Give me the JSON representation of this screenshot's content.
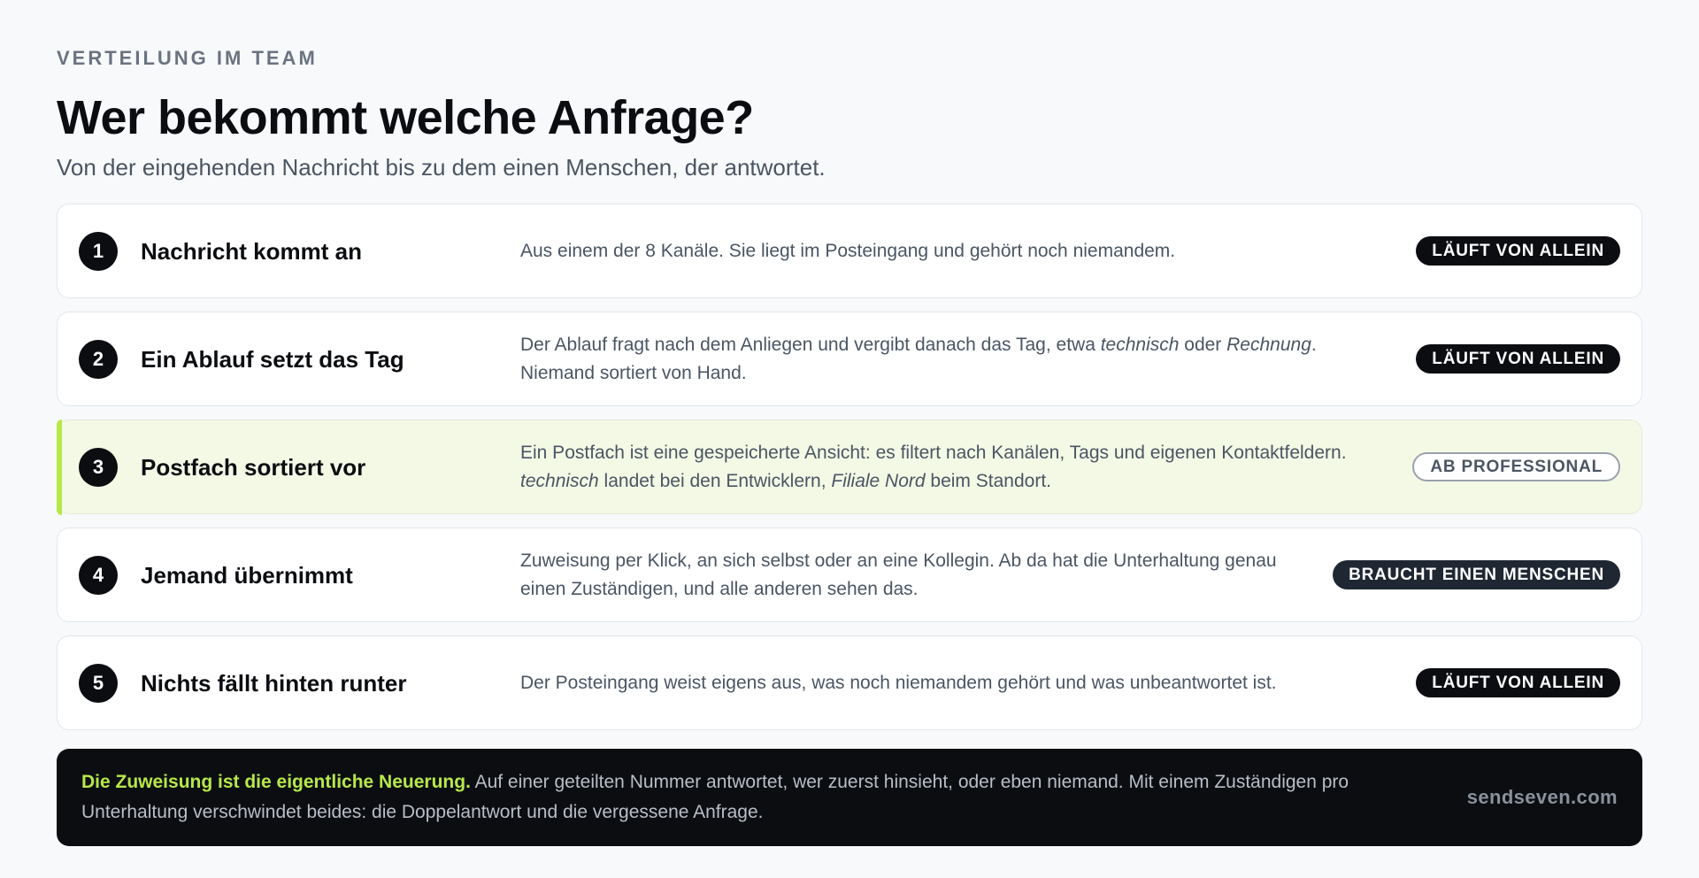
{
  "header": {
    "eyebrow": "VERTEILUNG IM TEAM",
    "title": "Wer bekommt welche Anfrage?",
    "subtitle": "Von der eingehenden Nachricht bis zu dem einen Menschen, der antwortet."
  },
  "steps": [
    {
      "number": "1",
      "title": "Nachricht kommt an",
      "desc_parts": [
        "Aus einem der 8 Kanäle. Sie liegt im Posteingang und gehört noch niemandem."
      ],
      "badge": "LÄUFT VON ALLEIN",
      "badge_style": "auto"
    },
    {
      "number": "2",
      "title": "Ein Ablauf setzt das Tag",
      "desc_parts": [
        "Der Ablauf fragt nach dem Anliegen und vergibt danach das Tag, etwa ",
        "technisch",
        " oder ",
        "Rechnung",
        ". Niemand sortiert von Hand."
      ],
      "badge": "LÄUFT VON ALLEIN",
      "badge_style": "auto"
    },
    {
      "number": "3",
      "title": "Postfach sortiert vor",
      "desc_parts": [
        "Ein Postfach ist eine gespeicherte Ansicht: es filtert nach Kanälen, Tags und eigenen Kontaktfeldern. ",
        "technisch",
        " landet bei den Entwicklern, ",
        "Filiale Nord",
        " beim Standort."
      ],
      "badge": "AB PROFESSIONAL",
      "badge_style": "pro"
    },
    {
      "number": "4",
      "title": "Jemand übernimmt",
      "desc_parts": [
        "Zuweisung per Klick, an sich selbst oder an eine Kollegin. Ab da hat die Unterhaltung genau einen Zuständigen, und alle anderen sehen das."
      ],
      "badge": "BRAUCHT EINEN MENSCHEN",
      "badge_style": "human"
    },
    {
      "number": "5",
      "title": "Nichts fällt hinten runter",
      "desc_parts": [
        "Der Posteingang weist eigens aus, was noch niemandem gehört und was unbeantwortet ist."
      ],
      "badge": "LÄUFT VON ALLEIN",
      "badge_style": "auto"
    }
  ],
  "footer": {
    "highlight": "Die Zuweisung ist die eigentliche Neuerung.",
    "text": " Auf einer geteilten Nummer antwortet, wer zuerst hinsieht, oder eben niemand. Mit einem Zuständigen pro Unterhaltung verschwindet beides: die Doppelantwort und die vergessene Anfrage.",
    "brand": "sendseven.com"
  },
  "colors": {
    "accent": "#b6e84a",
    "dark": "#0b0d10",
    "highlight_bg": "#f4f9e6"
  }
}
